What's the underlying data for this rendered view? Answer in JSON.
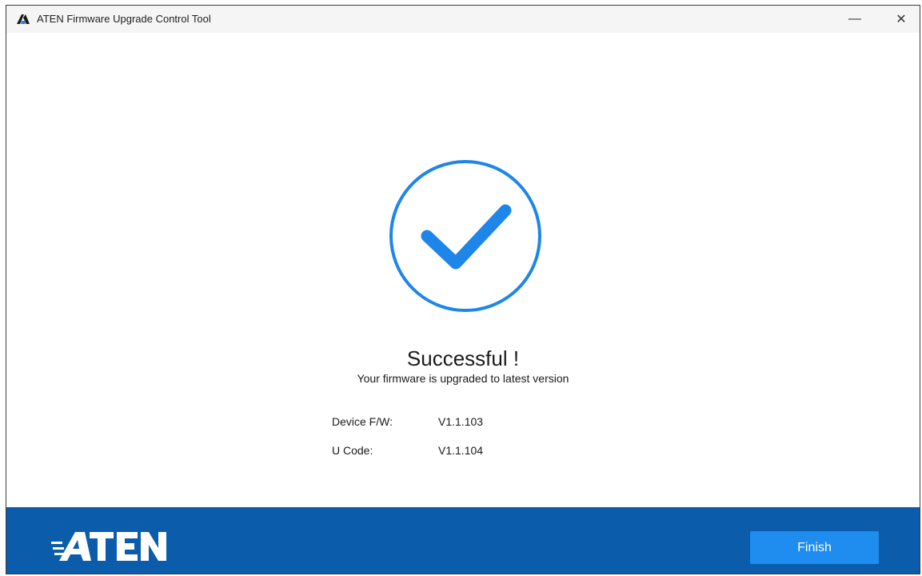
{
  "window": {
    "title": "ATEN Firmware Upgrade Control Tool",
    "minimize_glyph": "—",
    "close_glyph": "✕"
  },
  "status": {
    "title": "Successful !",
    "subtitle": "Your firmware is upgraded to latest version"
  },
  "info": [
    {
      "label": "Device F/W:",
      "value": "V1.1.103"
    },
    {
      "label": "U Code:",
      "value": "V1.1.104"
    }
  ],
  "footer": {
    "logo_text": "ATEN",
    "finish_label": "Finish"
  },
  "icons": {
    "app": "aten-app-icon",
    "status": "success-check-icon"
  },
  "colors": {
    "accent": "#1f8cf0",
    "footer_bg": "#0b5cab",
    "check": "#1e86e8"
  }
}
